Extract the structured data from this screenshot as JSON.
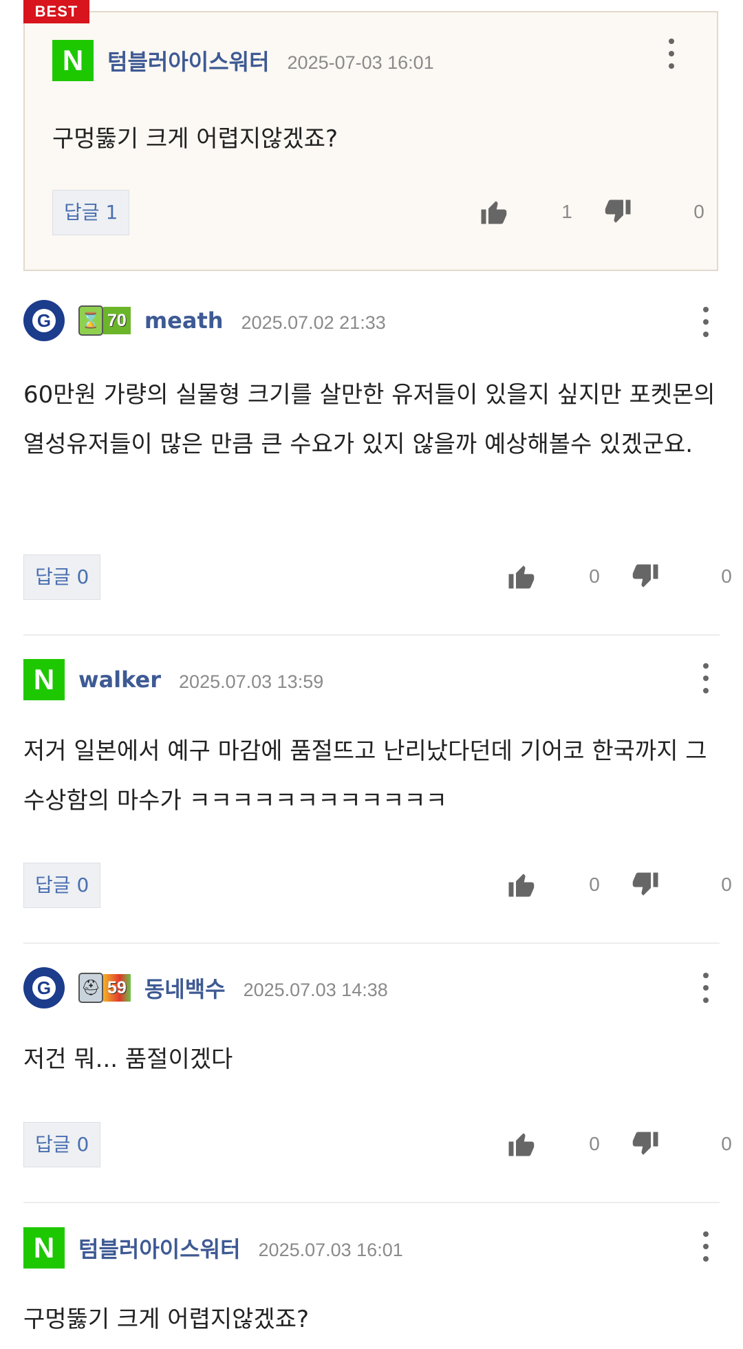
{
  "best": {
    "tag": "BEST",
    "avatar_letter": "N",
    "nickname": "텀블러아이스워터",
    "date": "2025-07-03 16:01",
    "body": "구멍뚫기 크게 어렵지않겠죠?",
    "reply_label": "답글",
    "reply_count": "1",
    "likes": "1",
    "dislikes": "0"
  },
  "comments": [
    {
      "avatar_letter": "G",
      "level": "70",
      "level_color": "#6bb52a",
      "nickname": "meath",
      "date": "2025.07.02 21:33",
      "body": "60만원 가량의 실물형 크기를 살만한 유저들이 있을지 싶지만 포켓몬의 열성유저들이 많은 만큼 큰 수요가 있지 않을까 예상해볼수 있겠군요.",
      "reply_label": "답글",
      "reply_count": "0",
      "likes": "0",
      "dislikes": "0"
    },
    {
      "avatar_letter": "N",
      "nickname": "walker",
      "date": "2025.07.03 13:59",
      "body": "저거 일본에서 예구 마감에 품절뜨고 난리났다던데 기어코 한국까지 그 수상함의 마수가 ㅋㅋㅋㅋㅋㅋㅋㅋㅋㅋㅋㅋ",
      "reply_label": "답글",
      "reply_count": "0",
      "likes": "0",
      "dislikes": "0"
    },
    {
      "avatar_letter": "G",
      "level": "59",
      "level_color": "#e0392b",
      "nickname": "동네백수",
      "date": "2025.07.03 14:38",
      "body": "저건 뭐... 품절이겠다",
      "reply_label": "답글",
      "reply_count": "0",
      "likes": "0",
      "dislikes": "0"
    },
    {
      "avatar_letter": "N",
      "nickname": "텀블러아이스워터",
      "date": "2025.07.03 16:01",
      "body": "구멍뚫기 크게 어렵지않겠죠?"
    }
  ],
  "icons": {
    "more": "more-vertical-icon",
    "like": "thumbs-up-icon",
    "dislike": "thumbs-down-icon"
  },
  "colors": {
    "naver_green": "#1ec800",
    "google_blue": "#1c3c8c",
    "nickname": "#3e5a94",
    "best_red": "#d8141c"
  }
}
